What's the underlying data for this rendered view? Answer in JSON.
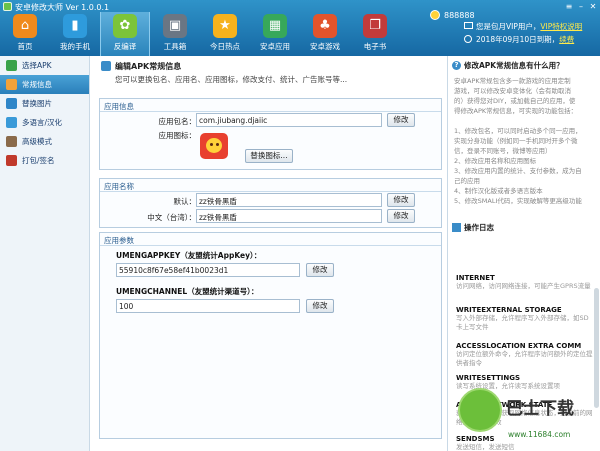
{
  "app": {
    "title": "安卓修改大师 Ver 1.0.0.1"
  },
  "toolbar": [
    {
      "label": "首页",
      "icon": "home-icon",
      "color": "#f08a1c",
      "glyph": "⌂"
    },
    {
      "label": "我的手机",
      "icon": "phone-icon",
      "color": "#2e9bdc",
      "glyph": "▮"
    },
    {
      "label": "反编译",
      "icon": "android-icon",
      "color": "#7cc43a",
      "glyph": "✿"
    },
    {
      "label": "工具箱",
      "icon": "toolbox-icon",
      "color": "#6a7684",
      "glyph": "▣"
    },
    {
      "label": "今日热点",
      "icon": "star-icon",
      "color": "#f6b21c",
      "glyph": "★"
    },
    {
      "label": "安卓应用",
      "icon": "apps-icon",
      "color": "#37a85a",
      "glyph": "▦"
    },
    {
      "label": "安卓游戏",
      "icon": "gamepad-icon",
      "color": "#e2542c",
      "glyph": "♣"
    },
    {
      "label": "电子书",
      "icon": "ebook-icon",
      "color": "#c23b3b",
      "glyph": "❐"
    }
  ],
  "account": {
    "user": "888888",
    "vip_text": "您是包月VIP用户，",
    "vip_link": "VIP特权说明",
    "expire_text": "2018年09月10日到期，",
    "renew_link": "续费"
  },
  "sidebar": [
    {
      "label": "选择APK",
      "icon": "select-apk-icon",
      "color": "#3aa34a"
    },
    {
      "label": "常规信息",
      "icon": "info-icon",
      "color": "#f2a23a"
    },
    {
      "label": "替换图片",
      "icon": "image-icon",
      "color": "#2f86c8"
    },
    {
      "label": "多语言/汉化",
      "icon": "globe-icon",
      "color": "#3a9ad8"
    },
    {
      "label": "高级模式",
      "icon": "tools-icon",
      "color": "#8a6a4a"
    },
    {
      "label": "打包/签名",
      "icon": "package-icon",
      "color": "#c0392b"
    }
  ],
  "main": {
    "title": "编辑APK常规信息",
    "desc": "您可以更换包名、应用名、应用图标，修改支付、统计、广告账号等...",
    "app_info": {
      "title": "应用信息",
      "package_label": "应用包名：",
      "package_value": "com.jiubang.djaiic",
      "modify_label": "修改",
      "icon_label": "应用图标：",
      "change_icon_label": "替换图标..."
    },
    "app_name": {
      "title": "应用名称",
      "default_label": "默认：",
      "default_value": "zz铁骨黑盾",
      "tw_label": "中文（台湾）：",
      "tw_value": "zz铁骨黑盾",
      "modify_label": "修改"
    },
    "app_params": {
      "title": "应用参数",
      "key1_label": "UMENGAPPKEY（友盟统计AppKey）：",
      "key1_value": "55910c8f67e58ef41b0023d1",
      "key2_label": "UMENGCHANNEL（友盟统计渠道号）：",
      "key2_value": "100",
      "modify_label": "修改"
    }
  },
  "right_panel": {
    "help_title": "修改APK常规信息有什么用？",
    "help_lines": [
      "安卓APK常规包含多一款游戏的应用定制",
      "游戏，可以修改安卓变体化（会有助取消",
      "的）获得您对DIY，或加载自己的应用，使",
      "得修改APK常规信息，可实现的功能包括：",
      "",
      "1、修改包名，可以同时启动多个同一应用，",
      "实现分身功能（例如同一手机同时开多个微",
      "信，登录不同账号，微博等应用）",
      "2、修改应用名称和应用图标",
      "3、修改应用内置的统计、支付参数，成为自",
      "己的应用",
      "4、制作汉化版或者多语言版本",
      "5、修改SMALI代码，实现破解等更高级功能"
    ],
    "log_title": "操作日志",
    "permissions": [
      {
        "name": "INTERNET",
        "desc": "访问网络，访问网络连接，可能产生GPRS流量"
      },
      {
        "name": "WRITEEXTERNAL STORAGE",
        "desc": "写入外部存储，允许程序写入外部存储，如SD卡上写文件"
      },
      {
        "name": "ACCESSLOCATION EXTRA COMM",
        "desc": "访问定位额外命令，允许程序访问额外的定位提供者指令"
      },
      {
        "name": "WRITESETTINGS",
        "desc": "读写系统设置，允许读写系统设置项"
      },
      {
        "name": "ACCESSNETWORK STATE",
        "desc": "获取网络状态，获取网络信息状态，如当前的网络连接是否有效"
      },
      {
        "name": "SENDSMS",
        "desc": "发送短信，发送短信"
      }
    ]
  },
  "watermark": {
    "text": "巴士下载",
    "url": "www.11684.com"
  }
}
